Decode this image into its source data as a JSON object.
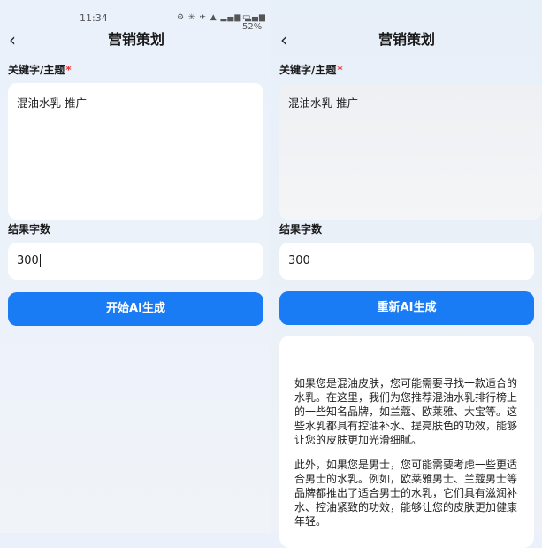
{
  "status_bar": {
    "time": "11:34",
    "icons": "⚙ ✳ ✈ ▲ ▂▄▆ ▂▄▆",
    "battery": "▭ 52%"
  },
  "header": {
    "title": "营销策划",
    "back_icon": "chevron-left-icon"
  },
  "form": {
    "keyword_label": "关键字/主题",
    "required_mark": "*",
    "keyword_value": "混油水乳 推广",
    "word_count_label": "结果字数",
    "word_count_value": "300"
  },
  "left": {
    "generate_button": "开始AI生成"
  },
  "right": {
    "regenerate_button": "重新AI生成",
    "result_paragraphs": [
      "如果您是混油皮肤，您可能需要寻找一款适合的水乳。在这里，我们为您推荐混油水乳排行榜上的一些知名品牌，如兰蔻、欧莱雅、大宝等。这些水乳都具有控油补水、提亮肤色的功效，能够让您的皮肤更加光滑细腻。",
      "此外，如果您是男士，您可能需要考虑一些更适合男士的水乳。例如，欧莱雅男士、兰蔻男士等品牌都推出了适合男士的水乳，它们具有滋润补水、控油紧致的功效，能够让您的皮肤更加健康年轻。"
    ]
  },
  "colors": {
    "accent": "#1a7cf5",
    "required": "#e53935",
    "background": "#eaf1fb"
  }
}
